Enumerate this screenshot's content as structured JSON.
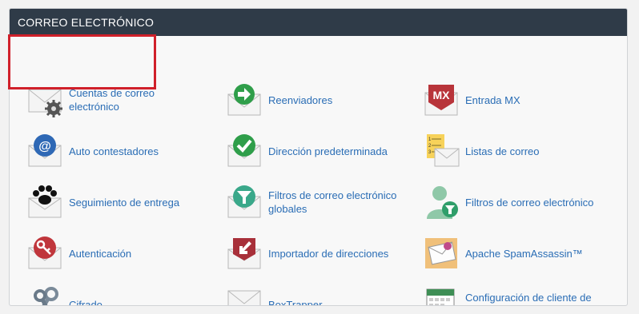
{
  "panel": {
    "title": "CORREO ELECTRÓNICO"
  },
  "items": [
    {
      "label": "Cuentas de correo electrónico",
      "icon": "envelope-gear-icon"
    },
    {
      "label": "Reenviadores",
      "icon": "forward-arrow-icon"
    },
    {
      "label": "Entrada MX",
      "icon": "mx-icon"
    },
    {
      "label": "Auto contestadores",
      "icon": "at-sign-icon"
    },
    {
      "label": "Dirección predeterminada",
      "icon": "checkmark-icon"
    },
    {
      "label": "Listas de correo",
      "icon": "mailing-list-icon"
    },
    {
      "label": "Seguimiento de entrega",
      "icon": "paw-print-icon"
    },
    {
      "label": "Filtros de correo electrónico globales",
      "icon": "funnel-icon"
    },
    {
      "label": "Filtros de correo electrónico",
      "icon": "user-funnel-icon"
    },
    {
      "label": "Autenticación",
      "icon": "key-icon"
    },
    {
      "label": "Importador de direcciones",
      "icon": "import-arrow-icon"
    },
    {
      "label": "Apache SpamAssassin™",
      "icon": "spam-mail-icon"
    },
    {
      "label": "Cifrado",
      "icon": "keys-icon"
    },
    {
      "label": "BoxTrapper",
      "icon": "cube-icon"
    },
    {
      "label": "Configuración de cliente de calendarios y contactos",
      "icon": "calendar-gear-icon"
    }
  ],
  "colors": {
    "header_bg": "#2f3b48",
    "link": "#2a6db5",
    "highlight": "#d0202a",
    "green": "#2f9e4a",
    "red": "#b8343a",
    "blue": "#2e68b5"
  }
}
